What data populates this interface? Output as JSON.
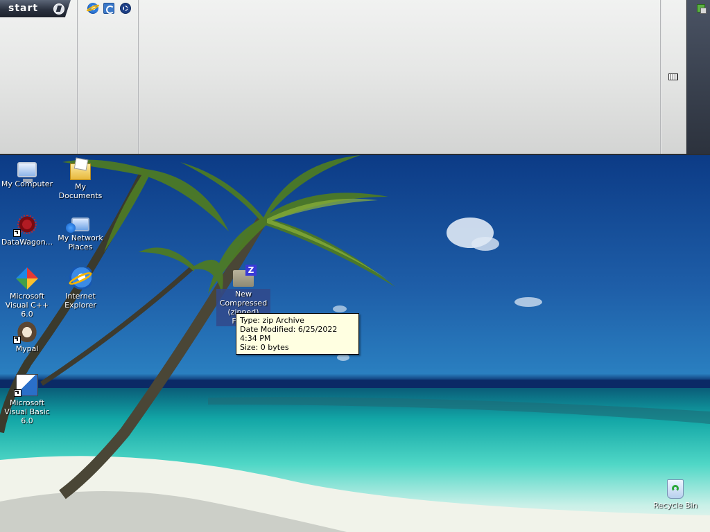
{
  "taskbar": {
    "start_label": "start",
    "quick_launch": [
      {
        "name": "internet-explorer-icon"
      },
      {
        "name": "show-desktop-icon"
      },
      {
        "name": "windows-media-player-icon"
      }
    ],
    "tray": {
      "keyboard_icon": "keyboard-icon",
      "network_icon": "network-icon"
    }
  },
  "desktop": {
    "icons": [
      {
        "id": "my-computer",
        "label": "My Computer",
        "icon": "computer-icon"
      },
      {
        "id": "my-documents",
        "label": "My Documents",
        "icon": "documents-folder-icon"
      },
      {
        "id": "datawagon",
        "label": "DataWagon...",
        "icon": "datawagon-icon",
        "shortcut": true
      },
      {
        "id": "my-network-places",
        "label": "My Network Places",
        "icon": "network-places-icon"
      },
      {
        "id": "visual-cpp",
        "label": "Microsoft Visual C++ 6.0",
        "icon": "visual-cpp-icon",
        "shortcut": true
      },
      {
        "id": "internet-explorer",
        "label": "Internet Explorer",
        "icon": "internet-explorer-icon"
      },
      {
        "id": "mypal",
        "label": "Mypal",
        "icon": "mypal-icon",
        "shortcut": true
      },
      {
        "id": "visual-basic",
        "label": "Microsoft Visual Basic 6.0",
        "icon": "visual-basic-icon",
        "shortcut": true
      },
      {
        "id": "new-compressed-folder",
        "label": "New Compressed (zipped) Fold...",
        "icon": "zip-folder-icon",
        "selected": true
      },
      {
        "id": "recycle-bin",
        "label": "Recycle Bin",
        "icon": "recycle-bin-icon"
      }
    ]
  },
  "tooltip": {
    "type": "Type: zip Archive",
    "modified": "Date Modified: 6/25/2022 4:34 PM",
    "size": "Size: 0 bytes"
  },
  "colors": {
    "taskbar": "#e6e7e6",
    "start_button": "#2b3240",
    "tooltip_bg": "#ffffe1",
    "selection": "#31498b"
  }
}
